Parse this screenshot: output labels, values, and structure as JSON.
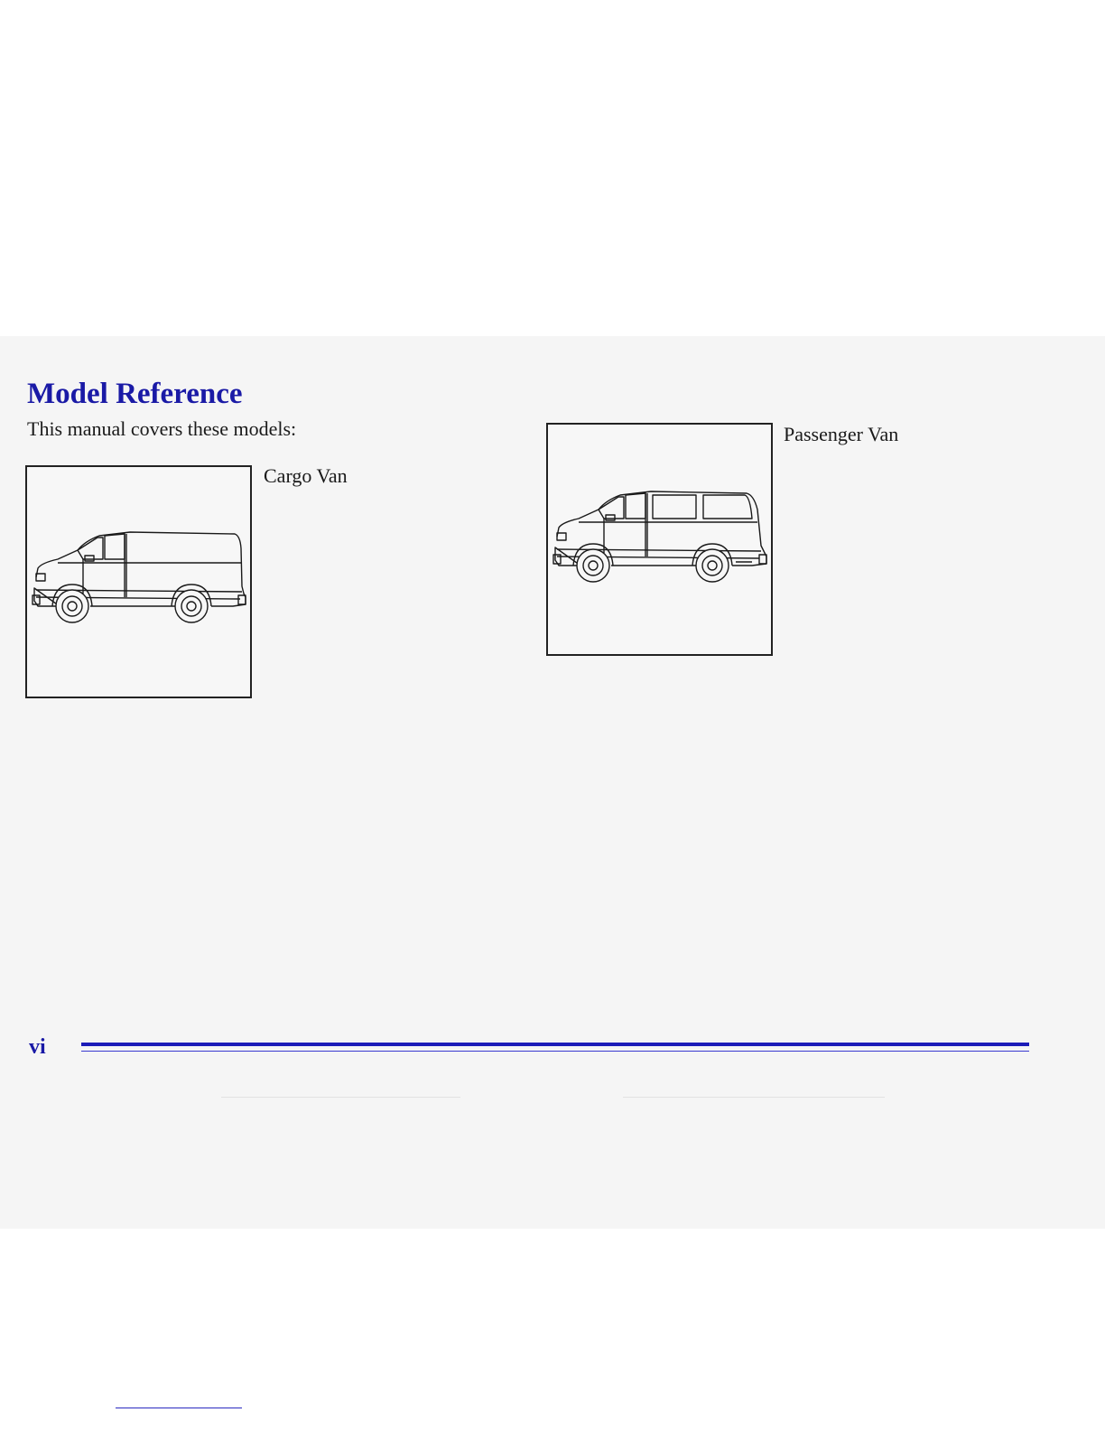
{
  "page": {
    "title": "Model Reference",
    "intro": "This manual covers these models:",
    "page_number": "vi"
  },
  "models": [
    {
      "name": "Cargo Van",
      "illustration": "cargo-van-icon"
    },
    {
      "name": "Passenger Van",
      "illustration": "passenger-van-icon"
    }
  ],
  "colors": {
    "heading": "#1a1aa6",
    "rule": "#1c1cb8",
    "band_background": "#f5f5f5"
  }
}
